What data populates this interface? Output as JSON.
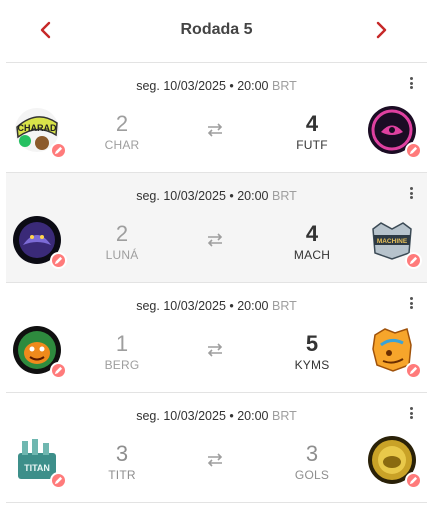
{
  "header": {
    "title": "Rodada 5"
  },
  "matches": [
    {
      "date": "seg. 10/03/2025 • 20:00",
      "tz": "BRT",
      "home": {
        "abbr": "CHAR",
        "score": "2"
      },
      "away": {
        "abbr": "FUTF",
        "score": "4"
      }
    },
    {
      "date": "seg. 10/03/2025 • 20:00",
      "tz": "BRT",
      "home": {
        "abbr": "LUNÁ",
        "score": "2"
      },
      "away": {
        "abbr": "MACH",
        "score": "4"
      }
    },
    {
      "date": "seg. 10/03/2025 • 20:00",
      "tz": "BRT",
      "home": {
        "abbr": "BERG",
        "score": "1"
      },
      "away": {
        "abbr": "KYMS",
        "score": "5"
      }
    },
    {
      "date": "seg. 10/03/2025 • 20:00",
      "tz": "BRT",
      "home": {
        "abbr": "TITR",
        "score": "3"
      },
      "away": {
        "abbr": "GOLS",
        "score": "3"
      }
    }
  ],
  "colors": {
    "accent": "#c62828",
    "badge": "#ff7b7b",
    "shaded_row": "#f5f5f5"
  },
  "icons": {
    "prev": "chevron-left-icon",
    "next": "chevron-right-icon",
    "more": "more-vertical-icon",
    "swap": "swap-icon",
    "edit": "pencil-icon"
  }
}
